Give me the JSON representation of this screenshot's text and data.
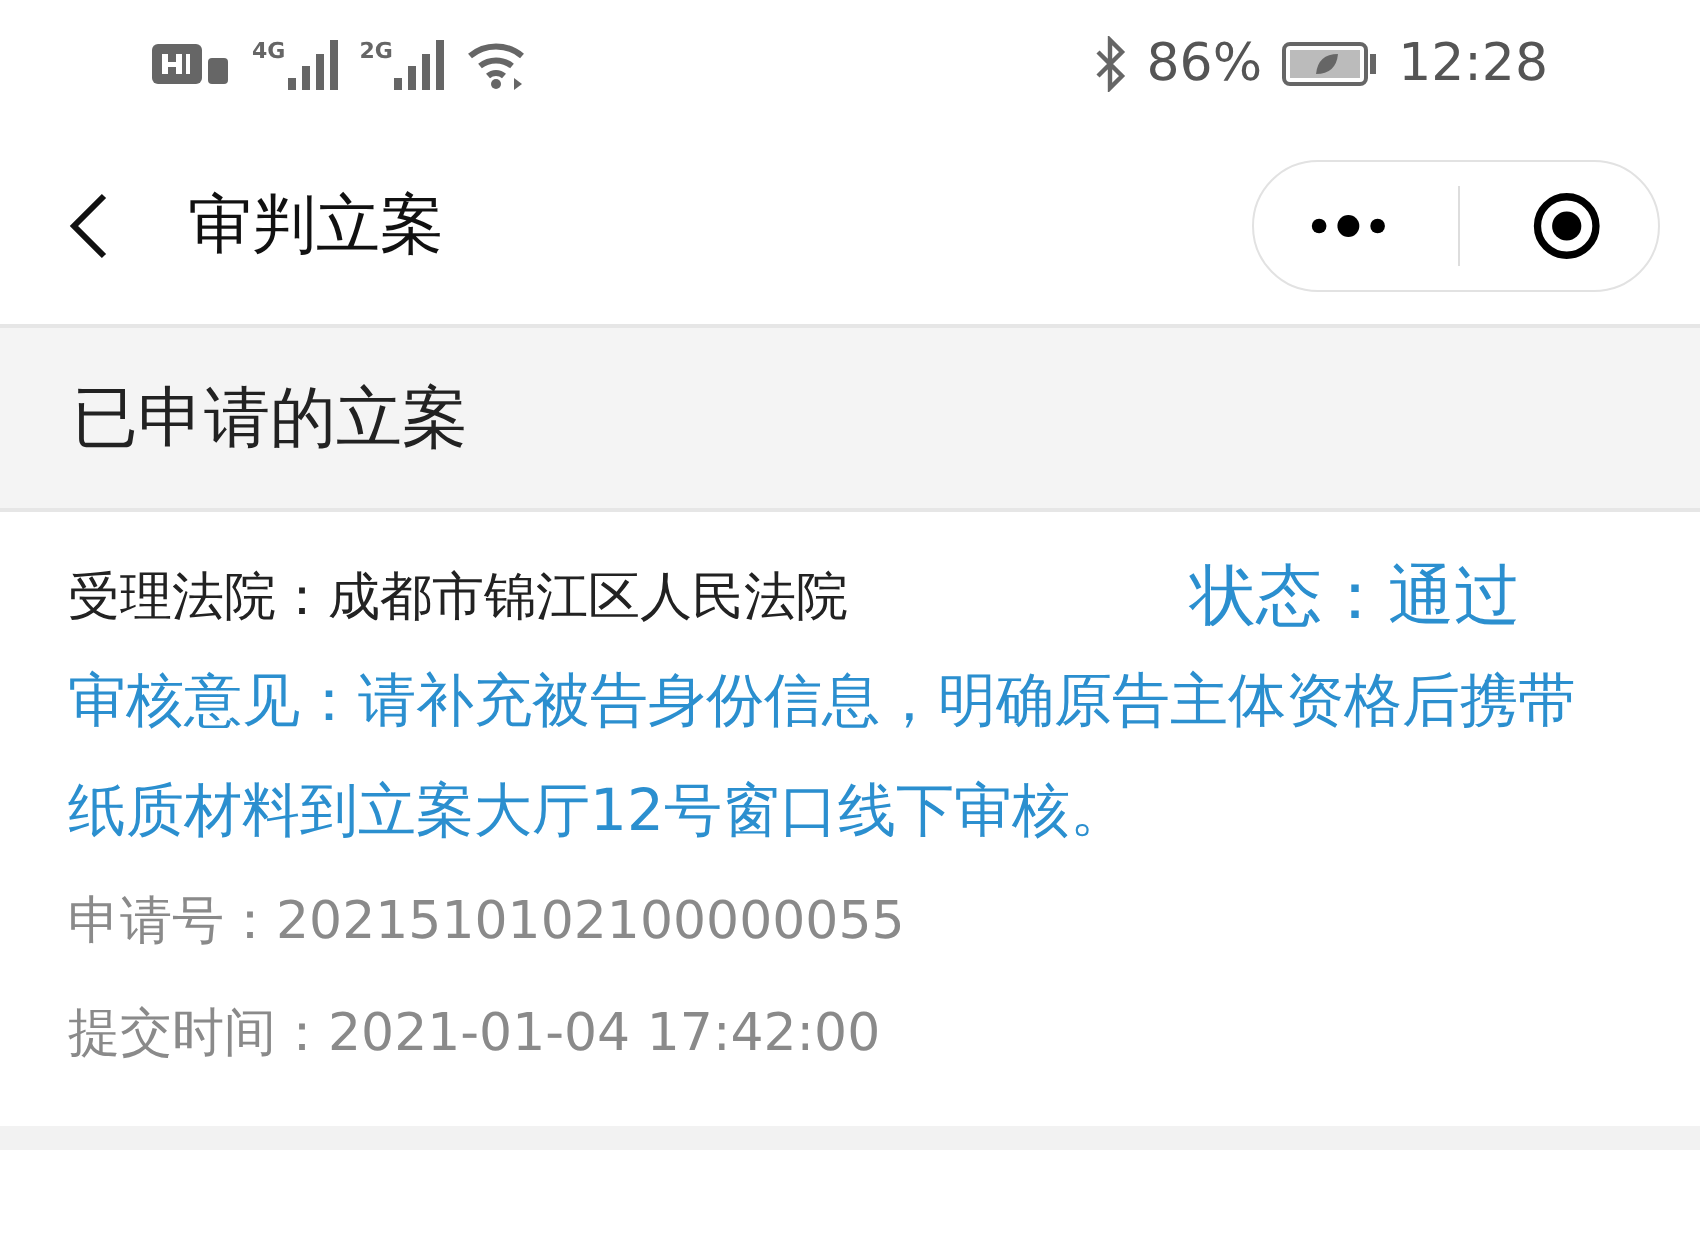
{
  "status_bar": {
    "battery_text": "86%",
    "time": "12:28",
    "network_1": "4G",
    "network_2": "2G"
  },
  "nav": {
    "title": "审判立案"
  },
  "section": {
    "title": "已申请的立案"
  },
  "cases": [
    {
      "court": "受理法院：成都市锦江区人民法院",
      "status": "状态：通过",
      "opinion": "审核意见：请补充被告身份信息，明确原告主体资格后携带纸质材料到立案大厅12号窗口线下审核。",
      "application_no": "申请号：2021510102100000055",
      "submitted": "提交时间：2021-01-04 17:42:00"
    }
  ]
}
